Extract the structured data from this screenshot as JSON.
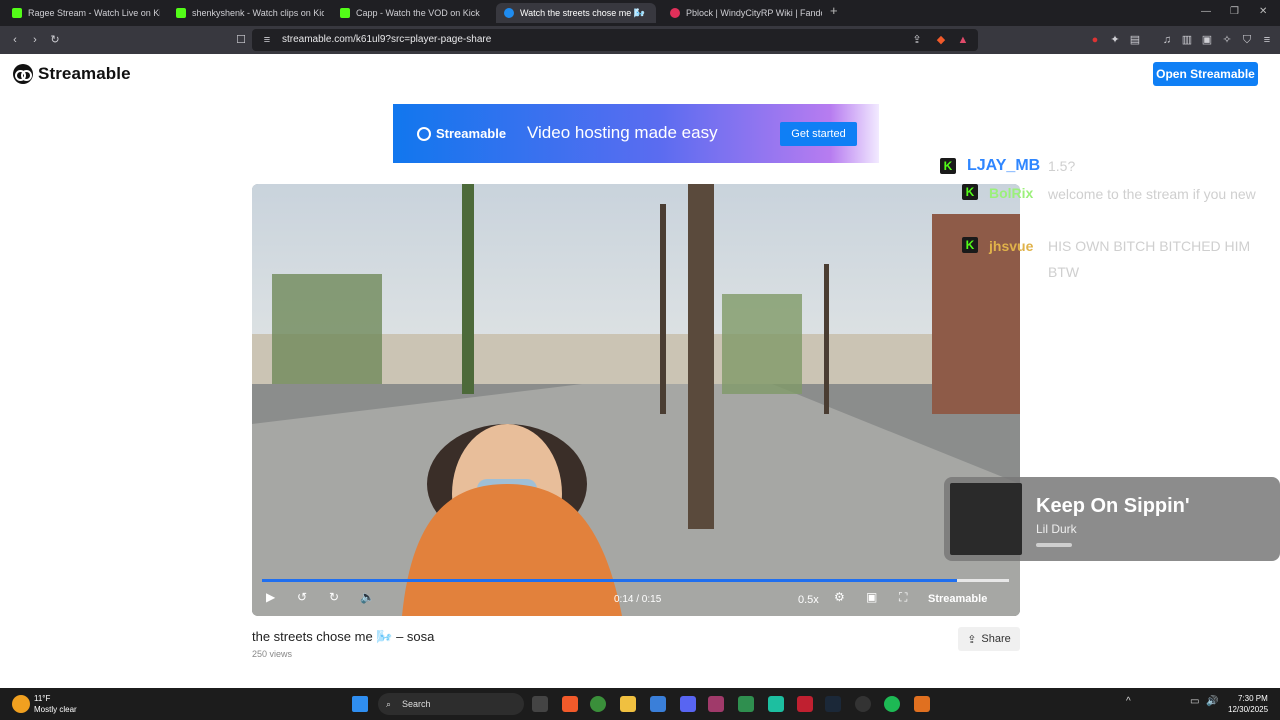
{
  "tabs": [
    {
      "title": "Ragee Stream - Watch Live on Ki",
      "icon": "kick-icon"
    },
    {
      "title": "shenkyshenk - Watch clips on Kick",
      "icon": "kick-icon"
    },
    {
      "title": "Capp - Watch the VOD on Kick",
      "icon": "kick-icon"
    },
    {
      "title": "Watch the streets chose me 🌬️",
      "icon": "streamable-icon"
    },
    {
      "title": "Pblock | WindyCityRP Wiki | Fandom",
      "icon": "fandom-icon"
    }
  ],
  "browser": {
    "url": "streamable.com/k61ul9?src=player-page-share"
  },
  "header": {
    "logo": "Streamable",
    "open_button": "Open Streamable"
  },
  "banner": {
    "brand": "Streamable",
    "tagline": "Video hosting made easy",
    "cta": "Get started"
  },
  "video": {
    "time": "0:14 / 0:15",
    "progress": 0.93,
    "speed": "0.5x",
    "watermark": "Streamable",
    "title": "the streets chose me 🌬️ – sosa",
    "views": "250 views",
    "share": "Share"
  },
  "chat": [
    {
      "user": "LJAY_MB",
      "message": "1.5?",
      "user_color": "#2f86ff"
    },
    {
      "user": "BolRix",
      "message": "welcome to the stream if you new",
      "user_color": "#9bf07a"
    },
    {
      "user": "jhsvue",
      "message": "HIS OWN BITCH BITCHED HIM BTW",
      "user_color": "#e0b24a"
    }
  ],
  "music": {
    "track": "Keep On Sippin'",
    "artist": "Lil Durk"
  },
  "taskbar": {
    "weather_temp": "11°F",
    "weather_condition": "Mostly clear",
    "search": "Search",
    "time": "7:30 PM",
    "date": "12/30/2025"
  }
}
